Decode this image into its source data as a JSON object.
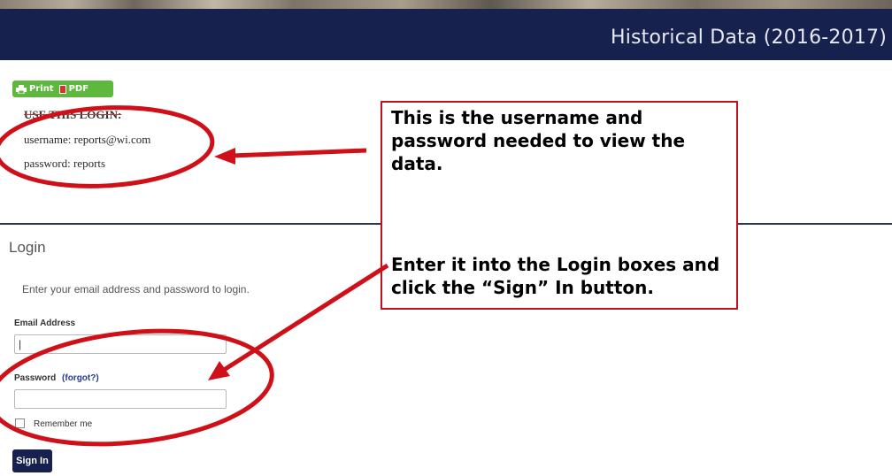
{
  "header": {
    "title": "Historical Data (2016-2017)"
  },
  "toolbar": {
    "print_label": "Print",
    "pdf_label": "PDF"
  },
  "login_info": {
    "heading": "USE THIS LOGIN:",
    "username": "username: reports@wi.com",
    "password": "password: reports"
  },
  "login": {
    "title": "Login",
    "description": "Enter your email address and password to login.",
    "email_label": "Email Address",
    "email_value": "|",
    "password_label": "Password",
    "forgot_label": "(forgot?)",
    "password_value": "",
    "remember_label": "Remember me",
    "signin_label": "Sign In"
  },
  "annotation": {
    "callout_1": "This is the username and password needed to view the data.",
    "callout_2": "Enter it into the Login boxes and click the “Sign” In button.",
    "accent_color": "#d01018"
  },
  "colors": {
    "header_bg": "#16214e",
    "button_green": "#5eb83e"
  },
  "icons": [
    "printer-icon",
    "pdf-icon",
    "checkbox-icon",
    "arrow-annotation",
    "circle-annotation"
  ]
}
